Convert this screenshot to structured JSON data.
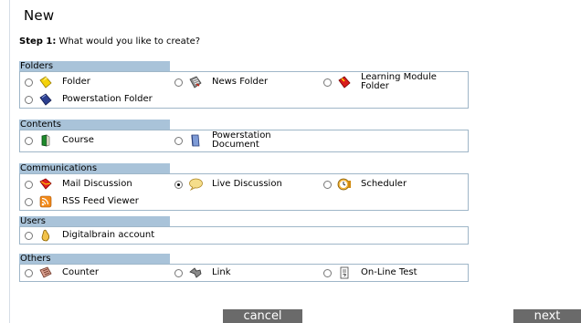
{
  "page": {
    "title": "New"
  },
  "step": {
    "prefix": "Step 1:",
    "question": "What would you like to create?"
  },
  "sections": [
    {
      "header": "Folders",
      "options": [
        {
          "label": "Folder",
          "icon": "folder-icon"
        },
        {
          "label": "News Folder",
          "icon": "news-folder-icon"
        },
        {
          "label": "Learning Module Folder",
          "icon": "learning-module-folder-icon"
        },
        {
          "label": "Powerstation Folder",
          "icon": "powerstation-folder-icon"
        }
      ]
    },
    {
      "header": "Contents",
      "options": [
        {
          "label": "Course",
          "icon": "course-icon"
        },
        {
          "label": "Powerstation Document",
          "icon": "powerstation-document-icon"
        }
      ]
    },
    {
      "header": "Communications",
      "options": [
        {
          "label": "Mail Discussion",
          "icon": "mail-discussion-icon"
        },
        {
          "label": "Live Discussion",
          "icon": "live-discussion-icon",
          "selected": true
        },
        {
          "label": "Scheduler",
          "icon": "scheduler-icon"
        },
        {
          "label": "RSS Feed Viewer",
          "icon": "rss-feed-icon"
        }
      ]
    },
    {
      "header": "Users",
      "options": [
        {
          "label": "Digitalbrain account",
          "icon": "user-account-icon"
        }
      ]
    },
    {
      "header": "Others",
      "options": [
        {
          "label": "Counter",
          "icon": "counter-icon"
        },
        {
          "label": "Link",
          "icon": "link-icon"
        },
        {
          "label": "On-Line Test",
          "icon": "online-test-icon"
        }
      ]
    }
  ],
  "buttons": {
    "cancel": "cancel",
    "next": "next"
  },
  "colors": {
    "header_bg": "#a9c3d9",
    "box_border": "#9fb6c8",
    "button_bg": "#6a6a6a"
  }
}
